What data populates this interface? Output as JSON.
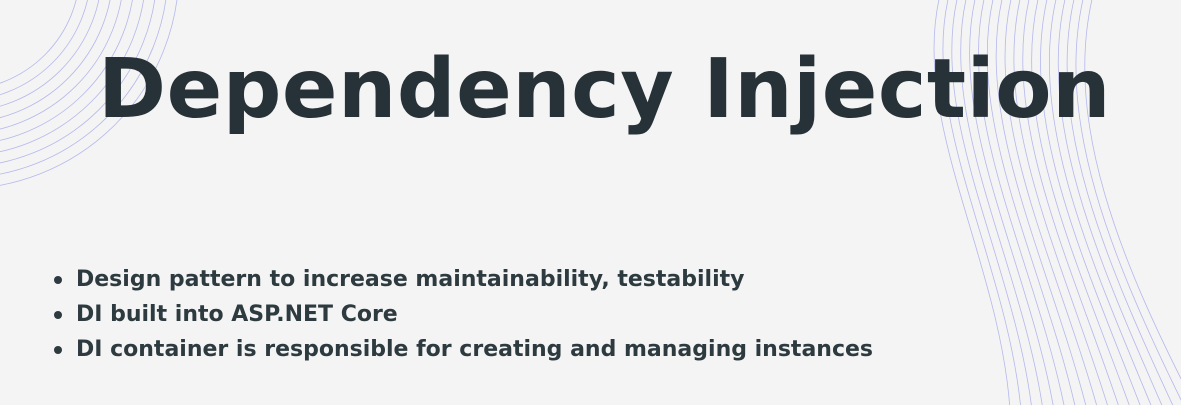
{
  "slide": {
    "title": "Dependency Injection",
    "bullets": [
      {
        "text": "Design pattern to increase maintainability, testability"
      },
      {
        "text": "DI built into ASP.NET Core"
      },
      {
        "text": "DI container is responsible for creating and managing instances"
      }
    ]
  },
  "colors": {
    "background": "#f4f4f4",
    "title": "#263238",
    "body_text": "#2d3a3f",
    "decoration_lines": "#7f86e6"
  }
}
